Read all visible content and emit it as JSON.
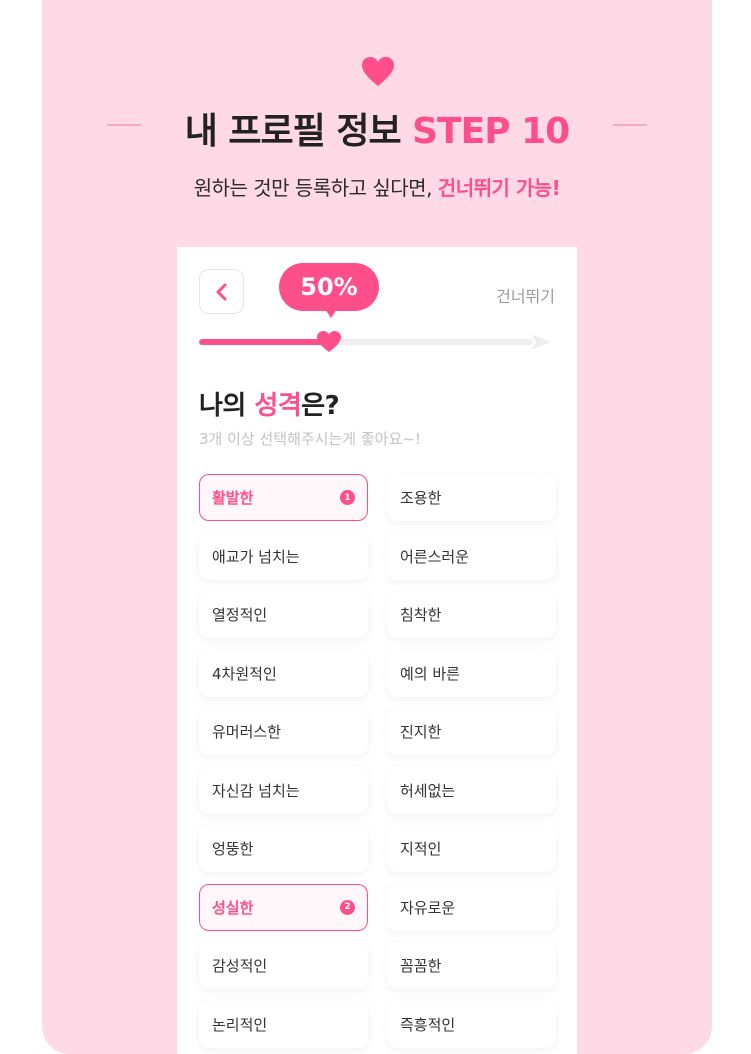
{
  "header": {
    "title_main": "내 프로필 정보",
    "title_step": "STEP 10",
    "subtitle_main": "원하는 것만 등록하고 싶다면,",
    "subtitle_accent": "건너뛰기 가능!",
    "icon": "heart-icon"
  },
  "screen": {
    "back_icon": "chevron-left-icon",
    "progress_label": "50%",
    "progress_value": 0.39,
    "skip_label": "건너뛰기",
    "question_prefix": "나의",
    "question_accent": "성격",
    "question_suffix": "은?",
    "hint": "3개 이상 선택해주시는게 좋아요~!",
    "options": [
      {
        "label": "활발한",
        "selected": true,
        "order": "1"
      },
      {
        "label": "조용한",
        "selected": false,
        "order": ""
      },
      {
        "label": "애교가 넘치는",
        "selected": false,
        "order": ""
      },
      {
        "label": "어른스러운",
        "selected": false,
        "order": ""
      },
      {
        "label": "열정적인",
        "selected": false,
        "order": ""
      },
      {
        "label": "침착한",
        "selected": false,
        "order": ""
      },
      {
        "label": "4차원적인",
        "selected": false,
        "order": ""
      },
      {
        "label": "예의 바른",
        "selected": false,
        "order": ""
      },
      {
        "label": "유머러스한",
        "selected": false,
        "order": ""
      },
      {
        "label": "진지한",
        "selected": false,
        "order": ""
      },
      {
        "label": "자신감 넘치는",
        "selected": false,
        "order": ""
      },
      {
        "label": "허세없는",
        "selected": false,
        "order": ""
      },
      {
        "label": "엉뚱한",
        "selected": false,
        "order": ""
      },
      {
        "label": "지적인",
        "selected": false,
        "order": ""
      },
      {
        "label": "성실한",
        "selected": true,
        "order": "2"
      },
      {
        "label": "자유로운",
        "selected": false,
        "order": ""
      },
      {
        "label": "감성적인",
        "selected": false,
        "order": ""
      },
      {
        "label": "꼼꼼한",
        "selected": false,
        "order": ""
      },
      {
        "label": "논리적인",
        "selected": false,
        "order": ""
      },
      {
        "label": "즉흥적인",
        "selected": false,
        "order": ""
      }
    ]
  },
  "colors": {
    "accent": "#ff4f8b",
    "background": "#ffd9e6"
  }
}
